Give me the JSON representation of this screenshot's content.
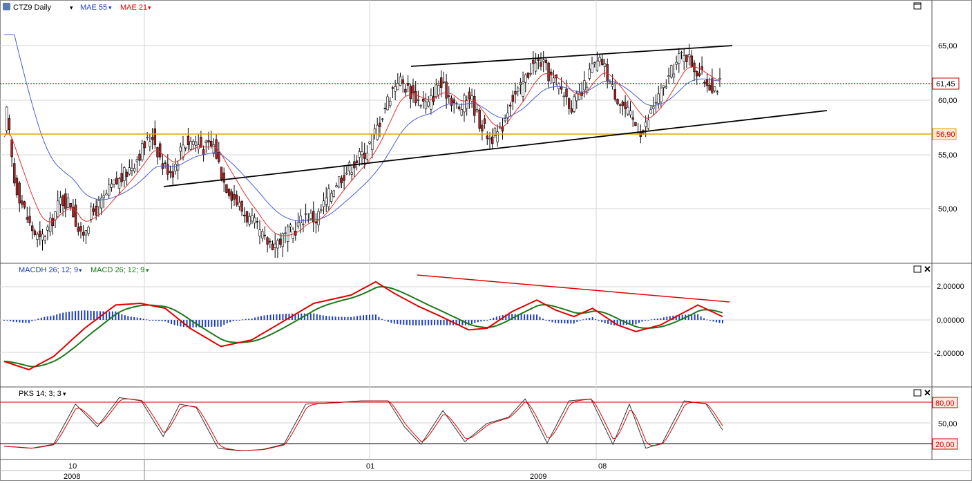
{
  "main_panel": {
    "symbol": "CTZ9 Daily",
    "symbol_menu": "▾",
    "legend": [
      {
        "label": "MAE 55",
        "color": "#1f3fbf"
      },
      {
        "label": "MAE 21",
        "color": "#e00000"
      }
    ],
    "price_ticks": [
      "65,00",
      "60,00",
      "55,00",
      "50,00"
    ],
    "last_price_label": "61,45",
    "support_level_label": "56,90",
    "last_price": 61.45,
    "support_level": 56.9
  },
  "macd_panel": {
    "legend": [
      {
        "label": "MACDH 26; 12; 9",
        "color": "#1f3fbf"
      },
      {
        "label": "MACD 26; 12; 9",
        "color": "#1a7a1a"
      }
    ],
    "ticks": [
      "2,00000",
      "0,00000",
      "-2,00000"
    ]
  },
  "stoch_panel": {
    "legend": [
      {
        "label": "PKS 14; 3; 3",
        "color": "#000000"
      }
    ],
    "ticks": [
      "80,00",
      "50,00",
      "20,00"
    ]
  },
  "time_axis": {
    "ticks": [
      "10",
      "01",
      "08"
    ],
    "years": [
      "2008",
      "2009"
    ]
  },
  "colors": {
    "up_candle": "#ffffff",
    "down_candle": "#b22222",
    "ma55": "#4a5ad8",
    "ma21": "#e03030",
    "support": "#e0a000",
    "last_price": "#cc0000",
    "macd_line": "#e00000",
    "macd_signal": "#1a7a1a",
    "histogram": "#1f3fbf",
    "grid": "#d6d6d6"
  },
  "chart_data": [
    {
      "type": "candlestick",
      "series": [
        {
          "name": "CTZ9 Daily"
        },
        {
          "name": "MAE 55"
        },
        {
          "name": "MAE 21"
        }
      ],
      "close_path": [
        [
          0,
          56.6
        ],
        [
          1,
          58.8
        ],
        [
          4,
          52.5
        ],
        [
          7,
          50.5
        ],
        [
          10,
          48.5
        ],
        [
          14,
          47.0
        ],
        [
          18,
          48.5
        ],
        [
          22,
          50.8
        ],
        [
          26,
          50.5
        ],
        [
          30,
          47.3
        ],
        [
          34,
          49.5
        ],
        [
          38,
          50.5
        ],
        [
          42,
          52.0
        ],
        [
          46,
          52.8
        ],
        [
          50,
          54.0
        ],
        [
          54,
          55.5
        ],
        [
          58,
          56.8
        ],
        [
          62,
          54.0
        ],
        [
          66,
          53.5
        ],
        [
          70,
          56.0
        ],
        [
          74,
          56.3
        ],
        [
          78,
          55.6
        ],
        [
          82,
          55.8
        ],
        [
          86,
          52.5
        ],
        [
          90,
          51.0
        ],
        [
          94,
          49.5
        ],
        [
          98,
          48.5
        ],
        [
          102,
          47.0
        ],
        [
          106,
          46.8
        ],
        [
          110,
          47.5
        ],
        [
          114,
          48.2
        ],
        [
          118,
          49.5
        ],
        [
          122,
          49.0
        ],
        [
          126,
          50.8
        ],
        [
          130,
          52.5
        ],
        [
          134,
          53.5
        ],
        [
          138,
          54.5
        ],
        [
          142,
          55.5
        ],
        [
          146,
          57.5
        ],
        [
          150,
          60.0
        ],
        [
          154,
          62.0
        ],
        [
          158,
          61.0
        ],
        [
          162,
          60.0
        ],
        [
          166,
          59.5
        ],
        [
          170,
          61.5
        ],
        [
          174,
          60.5
        ],
        [
          178,
          59.0
        ],
        [
          182,
          60.5
        ],
        [
          186,
          58.0
        ],
        [
          190,
          56.5
        ],
        [
          194,
          57.0
        ],
        [
          198,
          60.0
        ],
        [
          202,
          61.0
        ],
        [
          206,
          63.0
        ],
        [
          210,
          63.5
        ],
        [
          214,
          62.0
        ],
        [
          218,
          61.0
        ],
        [
          222,
          59.5
        ],
        [
          226,
          60.5
        ],
        [
          230,
          63.0
        ],
        [
          234,
          63.5
        ],
        [
          238,
          61.0
        ],
        [
          242,
          59.5
        ],
        [
          246,
          58.0
        ],
        [
          250,
          57.0
        ],
        [
          254,
          59.5
        ],
        [
          258,
          61.0
        ],
        [
          262,
          63.0
        ],
        [
          266,
          64.5
        ],
        [
          270,
          63.0
        ],
        [
          274,
          61.8
        ],
        [
          278,
          61.2
        ],
        [
          280,
          61.45
        ]
      ],
      "price_range": [
        46,
        66
      ]
    },
    {
      "type": "line",
      "series": [
        {
          "name": "MACDH 26; 12; 9"
        },
        {
          "name": "MACD 26; 12; 9"
        }
      ],
      "macd_path": [
        [
          0,
          -2.5
        ],
        [
          8,
          -3.0
        ],
        [
          16,
          -2.2
        ],
        [
          26,
          -0.5
        ],
        [
          36,
          0.9
        ],
        [
          44,
          1.0
        ],
        [
          52,
          0.7
        ],
        [
          60,
          -0.5
        ],
        [
          70,
          -1.6
        ],
        [
          80,
          -1.2
        ],
        [
          90,
          -0.1
        ],
        [
          100,
          1.0
        ],
        [
          112,
          1.5
        ],
        [
          120,
          2.3
        ],
        [
          126,
          1.6
        ],
        [
          134,
          0.8
        ],
        [
          140,
          0.3
        ],
        [
          150,
          -0.6
        ],
        [
          156,
          -0.5
        ],
        [
          164,
          0.5
        ],
        [
          172,
          1.2
        ],
        [
          178,
          0.6
        ],
        [
          184,
          0.2
        ],
        [
          190,
          0.7
        ],
        [
          198,
          -0.3
        ],
        [
          204,
          -0.7
        ],
        [
          212,
          -0.3
        ],
        [
          218,
          0.3
        ],
        [
          224,
          0.9
        ],
        [
          232,
          0.2
        ]
      ],
      "ylim": [
        -3.2,
        3.0
      ]
    },
    {
      "type": "line",
      "series": [
        {
          "name": "PKS 14; 3; 3"
        }
      ],
      "stoch_path": [
        [
          0,
          15
        ],
        [
          10,
          12
        ],
        [
          18,
          18
        ],
        [
          26,
          80
        ],
        [
          34,
          45
        ],
        [
          42,
          90
        ],
        [
          50,
          85
        ],
        [
          58,
          30
        ],
        [
          64,
          80
        ],
        [
          70,
          75
        ],
        [
          78,
          12
        ],
        [
          86,
          8
        ],
        [
          94,
          10
        ],
        [
          102,
          18
        ],
        [
          110,
          80
        ],
        [
          120,
          82
        ],
        [
          130,
          85
        ],
        [
          140,
          85
        ],
        [
          146,
          45
        ],
        [
          152,
          18
        ],
        [
          160,
          70
        ],
        [
          168,
          22
        ],
        [
          176,
          50
        ],
        [
          184,
          60
        ],
        [
          190,
          88
        ],
        [
          198,
          20
        ],
        [
          206,
          85
        ],
        [
          214,
          88
        ],
        [
          222,
          18
        ],
        [
          228,
          80
        ],
        [
          234,
          12
        ],
        [
          240,
          20
        ],
        [
          248,
          85
        ],
        [
          256,
          80
        ],
        [
          262,
          40
        ]
      ],
      "levels": [
        80,
        20
      ],
      "ylim": [
        0,
        100
      ]
    }
  ]
}
